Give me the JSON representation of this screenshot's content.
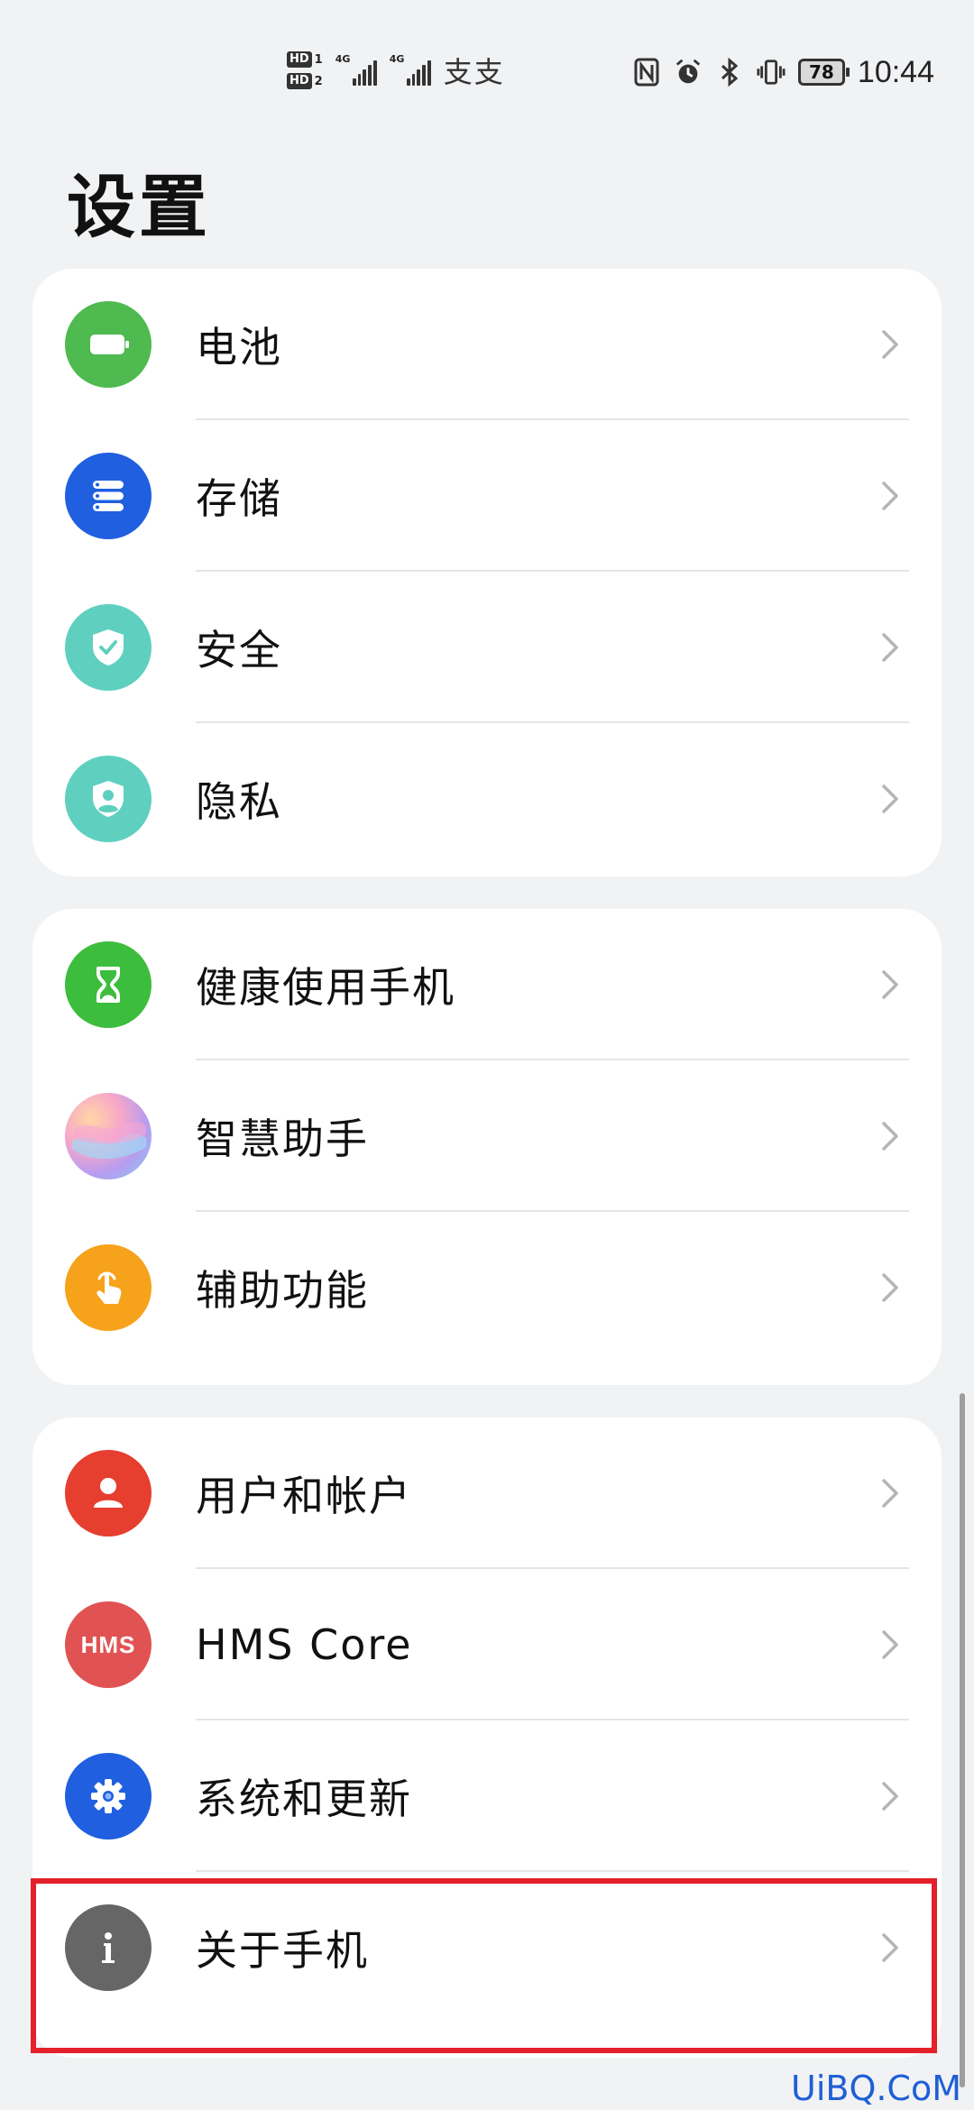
{
  "status_bar": {
    "hd1": "HD",
    "hd1_num": "1",
    "hd2": "HD",
    "hd2_num": "2",
    "net1": "4G",
    "net2": "4G",
    "wifi_glyphs": "支支",
    "battery": "78",
    "time": "10:44"
  },
  "page": {
    "title": "设置"
  },
  "groups": [
    {
      "items": [
        {
          "label": "电池",
          "icon": "battery-icon",
          "color": "#4fba4f"
        },
        {
          "label": "存储",
          "icon": "storage-icon",
          "color": "#1f5fe0"
        },
        {
          "label": "安全",
          "icon": "shield-check-icon",
          "color": "#5fd0bf"
        },
        {
          "label": "隐私",
          "icon": "privacy-shield-icon",
          "color": "#5fd0bf"
        }
      ]
    },
    {
      "items": [
        {
          "label": "健康使用手机",
          "icon": "hourglass-icon",
          "color": "#3dbd3d"
        },
        {
          "label": "智慧助手",
          "icon": "assistant-icon",
          "color": "#c9a6e6"
        },
        {
          "label": "辅助功能",
          "icon": "hand-tap-icon",
          "color": "#f7a21b"
        }
      ]
    },
    {
      "items": [
        {
          "label": "用户和帐户",
          "icon": "user-icon",
          "color": "#e63e2f"
        },
        {
          "label": "HMS Core",
          "icon": "hms-icon",
          "color": "#e15353"
        },
        {
          "label": "系统和更新",
          "icon": "gear-icon",
          "color": "#1f5fe0"
        },
        {
          "label": "关于手机",
          "icon": "info-icon",
          "color": "#666666"
        }
      ]
    }
  ],
  "hms_icon_text": "HMS",
  "watermark": "UiBQ.CoM"
}
